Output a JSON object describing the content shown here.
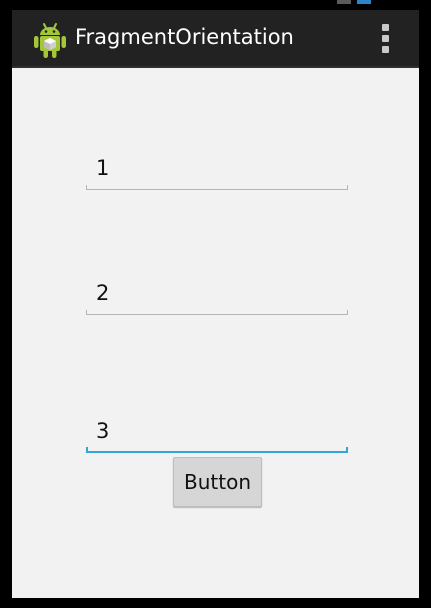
{
  "app": {
    "title": "FragmentOrientation",
    "icon": "android-robot-icon"
  },
  "action_bar": {
    "overflow_icon": "overflow-menu-icon"
  },
  "colors": {
    "action_bar_bg": "#222222",
    "content_bg": "#f2f2f2",
    "focus_accent": "#33a5d6",
    "android_green": "#a4c639"
  },
  "form": {
    "fields": [
      {
        "value": "1",
        "focused": false
      },
      {
        "value": "2",
        "focused": false
      },
      {
        "value": "3",
        "focused": true
      }
    ],
    "button_label": "Button"
  }
}
